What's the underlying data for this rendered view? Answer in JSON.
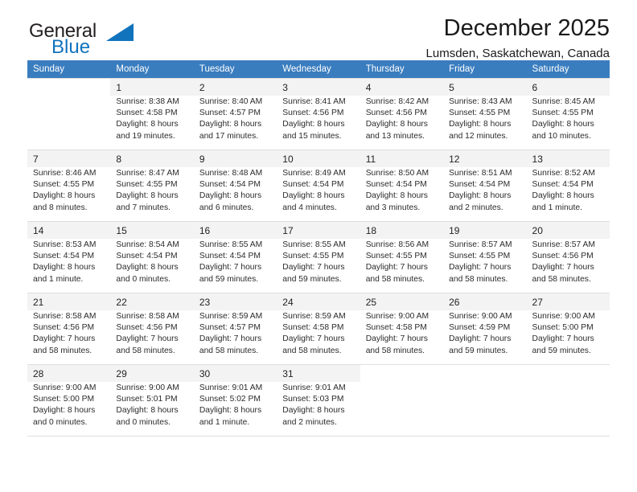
{
  "brand": {
    "name_part1": "General",
    "name_part2": "Blue",
    "triangle_color": "#1273bd"
  },
  "header": {
    "title": "December 2025",
    "subtitle": "Lumsden, Saskatchewan, Canada"
  },
  "theme": {
    "header_bg": "#3a7dbf",
    "header_text": "#ffffff",
    "cell_shaded": "#f3f3f3",
    "grid_line": "#dedede"
  },
  "weekdays": [
    "Sunday",
    "Monday",
    "Tuesday",
    "Wednesday",
    "Thursday",
    "Friday",
    "Saturday"
  ],
  "weeks": [
    [
      {
        "day": "",
        "sunrise": "",
        "sunset": "",
        "daylight1": "",
        "daylight2": ""
      },
      {
        "day": "1",
        "sunrise": "Sunrise: 8:38 AM",
        "sunset": "Sunset: 4:58 PM",
        "daylight1": "Daylight: 8 hours",
        "daylight2": "and 19 minutes."
      },
      {
        "day": "2",
        "sunrise": "Sunrise: 8:40 AM",
        "sunset": "Sunset: 4:57 PM",
        "daylight1": "Daylight: 8 hours",
        "daylight2": "and 17 minutes."
      },
      {
        "day": "3",
        "sunrise": "Sunrise: 8:41 AM",
        "sunset": "Sunset: 4:56 PM",
        "daylight1": "Daylight: 8 hours",
        "daylight2": "and 15 minutes."
      },
      {
        "day": "4",
        "sunrise": "Sunrise: 8:42 AM",
        "sunset": "Sunset: 4:56 PM",
        "daylight1": "Daylight: 8 hours",
        "daylight2": "and 13 minutes."
      },
      {
        "day": "5",
        "sunrise": "Sunrise: 8:43 AM",
        "sunset": "Sunset: 4:55 PM",
        "daylight1": "Daylight: 8 hours",
        "daylight2": "and 12 minutes."
      },
      {
        "day": "6",
        "sunrise": "Sunrise: 8:45 AM",
        "sunset": "Sunset: 4:55 PM",
        "daylight1": "Daylight: 8 hours",
        "daylight2": "and 10 minutes."
      }
    ],
    [
      {
        "day": "7",
        "sunrise": "Sunrise: 8:46 AM",
        "sunset": "Sunset: 4:55 PM",
        "daylight1": "Daylight: 8 hours",
        "daylight2": "and 8 minutes."
      },
      {
        "day": "8",
        "sunrise": "Sunrise: 8:47 AM",
        "sunset": "Sunset: 4:55 PM",
        "daylight1": "Daylight: 8 hours",
        "daylight2": "and 7 minutes."
      },
      {
        "day": "9",
        "sunrise": "Sunrise: 8:48 AM",
        "sunset": "Sunset: 4:54 PM",
        "daylight1": "Daylight: 8 hours",
        "daylight2": "and 6 minutes."
      },
      {
        "day": "10",
        "sunrise": "Sunrise: 8:49 AM",
        "sunset": "Sunset: 4:54 PM",
        "daylight1": "Daylight: 8 hours",
        "daylight2": "and 4 minutes."
      },
      {
        "day": "11",
        "sunrise": "Sunrise: 8:50 AM",
        "sunset": "Sunset: 4:54 PM",
        "daylight1": "Daylight: 8 hours",
        "daylight2": "and 3 minutes."
      },
      {
        "day": "12",
        "sunrise": "Sunrise: 8:51 AM",
        "sunset": "Sunset: 4:54 PM",
        "daylight1": "Daylight: 8 hours",
        "daylight2": "and 2 minutes."
      },
      {
        "day": "13",
        "sunrise": "Sunrise: 8:52 AM",
        "sunset": "Sunset: 4:54 PM",
        "daylight1": "Daylight: 8 hours",
        "daylight2": "and 1 minute."
      }
    ],
    [
      {
        "day": "14",
        "sunrise": "Sunrise: 8:53 AM",
        "sunset": "Sunset: 4:54 PM",
        "daylight1": "Daylight: 8 hours",
        "daylight2": "and 1 minute."
      },
      {
        "day": "15",
        "sunrise": "Sunrise: 8:54 AM",
        "sunset": "Sunset: 4:54 PM",
        "daylight1": "Daylight: 8 hours",
        "daylight2": "and 0 minutes."
      },
      {
        "day": "16",
        "sunrise": "Sunrise: 8:55 AM",
        "sunset": "Sunset: 4:54 PM",
        "daylight1": "Daylight: 7 hours",
        "daylight2": "and 59 minutes."
      },
      {
        "day": "17",
        "sunrise": "Sunrise: 8:55 AM",
        "sunset": "Sunset: 4:55 PM",
        "daylight1": "Daylight: 7 hours",
        "daylight2": "and 59 minutes."
      },
      {
        "day": "18",
        "sunrise": "Sunrise: 8:56 AM",
        "sunset": "Sunset: 4:55 PM",
        "daylight1": "Daylight: 7 hours",
        "daylight2": "and 58 minutes."
      },
      {
        "day": "19",
        "sunrise": "Sunrise: 8:57 AM",
        "sunset": "Sunset: 4:55 PM",
        "daylight1": "Daylight: 7 hours",
        "daylight2": "and 58 minutes."
      },
      {
        "day": "20",
        "sunrise": "Sunrise: 8:57 AM",
        "sunset": "Sunset: 4:56 PM",
        "daylight1": "Daylight: 7 hours",
        "daylight2": "and 58 minutes."
      }
    ],
    [
      {
        "day": "21",
        "sunrise": "Sunrise: 8:58 AM",
        "sunset": "Sunset: 4:56 PM",
        "daylight1": "Daylight: 7 hours",
        "daylight2": "and 58 minutes."
      },
      {
        "day": "22",
        "sunrise": "Sunrise: 8:58 AM",
        "sunset": "Sunset: 4:56 PM",
        "daylight1": "Daylight: 7 hours",
        "daylight2": "and 58 minutes."
      },
      {
        "day": "23",
        "sunrise": "Sunrise: 8:59 AM",
        "sunset": "Sunset: 4:57 PM",
        "daylight1": "Daylight: 7 hours",
        "daylight2": "and 58 minutes."
      },
      {
        "day": "24",
        "sunrise": "Sunrise: 8:59 AM",
        "sunset": "Sunset: 4:58 PM",
        "daylight1": "Daylight: 7 hours",
        "daylight2": "and 58 minutes."
      },
      {
        "day": "25",
        "sunrise": "Sunrise: 9:00 AM",
        "sunset": "Sunset: 4:58 PM",
        "daylight1": "Daylight: 7 hours",
        "daylight2": "and 58 minutes."
      },
      {
        "day": "26",
        "sunrise": "Sunrise: 9:00 AM",
        "sunset": "Sunset: 4:59 PM",
        "daylight1": "Daylight: 7 hours",
        "daylight2": "and 59 minutes."
      },
      {
        "day": "27",
        "sunrise": "Sunrise: 9:00 AM",
        "sunset": "Sunset: 5:00 PM",
        "daylight1": "Daylight: 7 hours",
        "daylight2": "and 59 minutes."
      }
    ],
    [
      {
        "day": "28",
        "sunrise": "Sunrise: 9:00 AM",
        "sunset": "Sunset: 5:00 PM",
        "daylight1": "Daylight: 8 hours",
        "daylight2": "and 0 minutes."
      },
      {
        "day": "29",
        "sunrise": "Sunrise: 9:00 AM",
        "sunset": "Sunset: 5:01 PM",
        "daylight1": "Daylight: 8 hours",
        "daylight2": "and 0 minutes."
      },
      {
        "day": "30",
        "sunrise": "Sunrise: 9:01 AM",
        "sunset": "Sunset: 5:02 PM",
        "daylight1": "Daylight: 8 hours",
        "daylight2": "and 1 minute."
      },
      {
        "day": "31",
        "sunrise": "Sunrise: 9:01 AM",
        "sunset": "Sunset: 5:03 PM",
        "daylight1": "Daylight: 8 hours",
        "daylight2": "and 2 minutes."
      },
      {
        "day": "",
        "sunrise": "",
        "sunset": "",
        "daylight1": "",
        "daylight2": ""
      },
      {
        "day": "",
        "sunrise": "",
        "sunset": "",
        "daylight1": "",
        "daylight2": ""
      },
      {
        "day": "",
        "sunrise": "",
        "sunset": "",
        "daylight1": "",
        "daylight2": ""
      }
    ]
  ]
}
